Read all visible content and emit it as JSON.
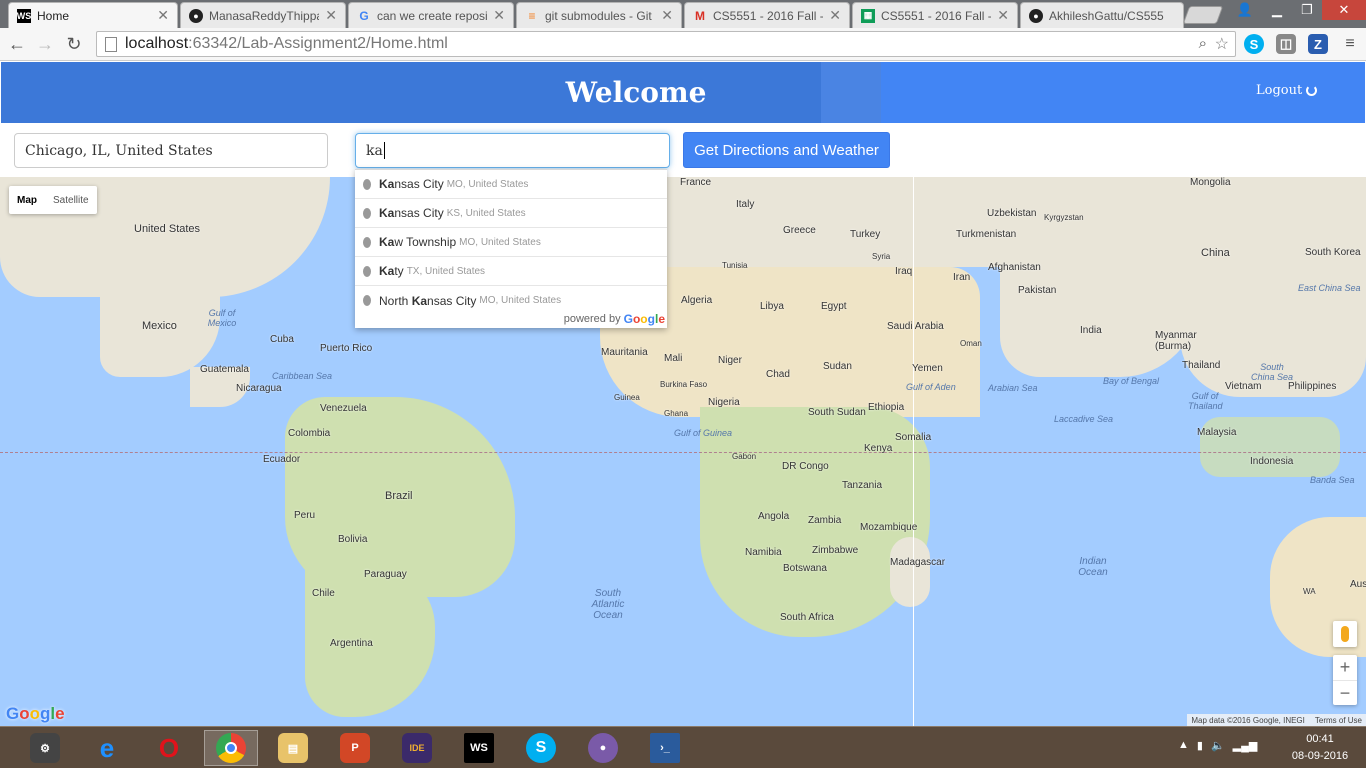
{
  "browser": {
    "tabs": [
      {
        "title": "Home",
        "favicon": "WS"
      },
      {
        "title": "ManasaReddyThippa",
        "favicon": "github"
      },
      {
        "title": "can we create reposit",
        "favicon": "google"
      },
      {
        "title": "git submodules - Git",
        "favicon": "stackoverflow"
      },
      {
        "title": "CS5551 - 2016 Fall -",
        "favicon": "gmail"
      },
      {
        "title": "CS5551 - 2016 Fall -",
        "favicon": "sheets"
      },
      {
        "title": "AkhileshGattu/CS555",
        "favicon": "github"
      }
    ],
    "url_host": "localhost",
    "url_path": ":63342/Lab-Assignment2/Home.html"
  },
  "header": {
    "title": "Welcome",
    "logout_label": "Logout"
  },
  "form": {
    "origin_value": "Chicago, IL, United States",
    "destination_value": "ka",
    "submit_label": "Get Directions and Weather"
  },
  "autocomplete": {
    "items": [
      {
        "match": "Ka",
        "rest": "nsas City",
        "secondary": "MO, United States"
      },
      {
        "match": "Ka",
        "rest": "nsas City",
        "secondary": "KS, United States"
      },
      {
        "match": "Ka",
        "rest": "w Township",
        "secondary": "MO, United States"
      },
      {
        "match": "Ka",
        "rest": "ty",
        "secondary": "TX, United States"
      },
      {
        "prefix": "North ",
        "match": "Ka",
        "rest": "nsas City",
        "secondary": "MO, United States"
      }
    ],
    "powered_by": "powered by",
    "google": "Google"
  },
  "map": {
    "type_map": "Map",
    "type_satellite": "Satellite",
    "attribution": "Map data ©2016 Google, INEGI",
    "terms": "Terms of Use",
    "logo": "Google",
    "zoom_in": "+",
    "zoom_out": "−",
    "labels": {
      "united_states": "United States",
      "mexico": "Mexico",
      "cuba": "Cuba",
      "puerto_rico": "Puerto Rico",
      "guatemala": "Guatemala",
      "nicaragua": "Nicaragua",
      "venezuela": "Venezuela",
      "colombia": "Colombia",
      "ecuador": "Ecuador",
      "peru": "Peru",
      "brazil": "Brazil",
      "bolivia": "Bolivia",
      "paraguay": "Paraguay",
      "chile": "Chile",
      "argentina": "Argentina",
      "france": "France",
      "italy": "Italy",
      "greece": "Greece",
      "turkey": "Turkey",
      "syria": "Syria",
      "iraq": "Iraq",
      "iran": "Iran",
      "tunisia": "Tunisia",
      "algeria": "Algeria",
      "libya": "Libya",
      "egypt": "Egypt",
      "saudi_arabia": "Saudi Arabia",
      "oman": "Oman",
      "yemen": "Yemen",
      "mauritania": "Mauritania",
      "mali": "Mali",
      "niger": "Niger",
      "chad": "Chad",
      "sudan": "Sudan",
      "south_sudan": "South Sudan",
      "ethiopia": "Ethiopia",
      "somalia": "Somalia",
      "nigeria": "Nigeria",
      "guinea": "Guinea",
      "ghana": "Ghana",
      "burkina_faso": "Burkina Faso",
      "gabon": "Gabon",
      "dr_congo": "DR Congo",
      "kenya": "Kenya",
      "tanzania": "Tanzania",
      "angola": "Angola",
      "zambia": "Zambia",
      "mozambique": "Mozambique",
      "namibia": "Namibia",
      "zimbabwe": "Zimbabwe",
      "botswana": "Botswana",
      "madagascar": "Madagascar",
      "south_africa": "South Africa",
      "mongolia": "Mongolia",
      "uzbekistan": "Uzbekistan",
      "kyrgyzstan": "Kyrgyzstan",
      "turkmenistan": "Turkmenistan",
      "afghanistan": "Afghanistan",
      "pakistan": "Pakistan",
      "china": "China",
      "south_korea": "South Korea",
      "india": "India",
      "myanmar": "Myanmar (Burma)",
      "thailand": "Thailand",
      "vietnam": "Vietnam",
      "philippines": "Philippines",
      "malaysia": "Malaysia",
      "indonesia": "Indonesia",
      "aus": "Aus",
      "wa": "WA"
    },
    "seas": {
      "gulf_mexico": "Gulf of Mexico",
      "caribbean": "Caribbean Sea",
      "gulf_guinea": "Gulf of Guinea",
      "south_atlantic": "South Atlantic Ocean",
      "indian_ocean": "Indian Ocean",
      "arabian_sea": "Arabian Sea",
      "bay_bengal": "Bay of Bengal",
      "gulf_aden": "Gulf of Aden",
      "laccadive": "Laccadive Sea",
      "south_china_sea": "South China Sea",
      "east_china_sea": "East China Sea",
      "banda_sea": "Banda Sea",
      "gulf_thailand": "Gulf of Thailand"
    }
  },
  "taskbar": {
    "time": "00:41",
    "date": "08-09-2016"
  },
  "colors": {
    "header_blue": "#3c78d8",
    "button_blue": "#4285f4",
    "water": "#a3ccff",
    "land": "#e9e5d8"
  }
}
